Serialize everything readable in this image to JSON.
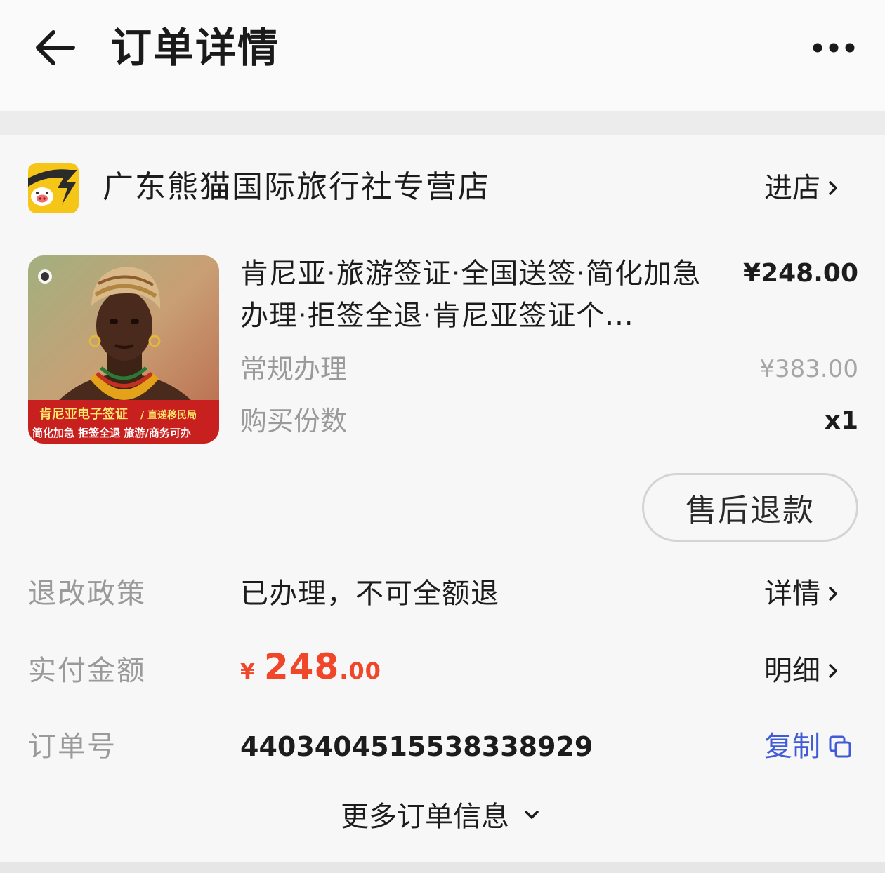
{
  "header": {
    "title": "订单详情",
    "back_icon": "back-arrow-icon",
    "more_icon": "more-dots-icon"
  },
  "shop": {
    "name": "广东熊猫国际旅行社专营店",
    "enter_label": "进店",
    "logo_icon": "shop-logo-icon"
  },
  "product": {
    "title": "肯尼亚·旅游签证·全国送签·简化加急办理·拒签全退·肯尼亚签证个...",
    "price": "¥248.00",
    "spec": "常规办理",
    "original_price": "¥383.00",
    "qty_label": "购买份数",
    "qty": "x1",
    "image_banner_line1": "肯尼亚电子签证",
    "image_banner_line1b": "/ 直递移民局",
    "image_banner_line2": "简化加急 拒签全退 旅游/商务可办"
  },
  "actions": {
    "refund_label": "售后退款"
  },
  "rows": {
    "policy_label": "退改政策",
    "policy_value": "已办理，不可全额退",
    "policy_link": "详情",
    "paid_label": "实付金额",
    "paid_currency": "¥",
    "paid_int": "248",
    "paid_dec": ".00",
    "paid_link": "明细",
    "order_label": "订单号",
    "order_value": "4403404515538338929",
    "copy_label": "复制"
  },
  "footer": {
    "more_label": "更多订单信息"
  },
  "colors": {
    "accent_red": "#f0462a",
    "link_blue": "#3f5bd6",
    "muted": "#9a9a9a",
    "logo_yellow": "#f5c518"
  }
}
